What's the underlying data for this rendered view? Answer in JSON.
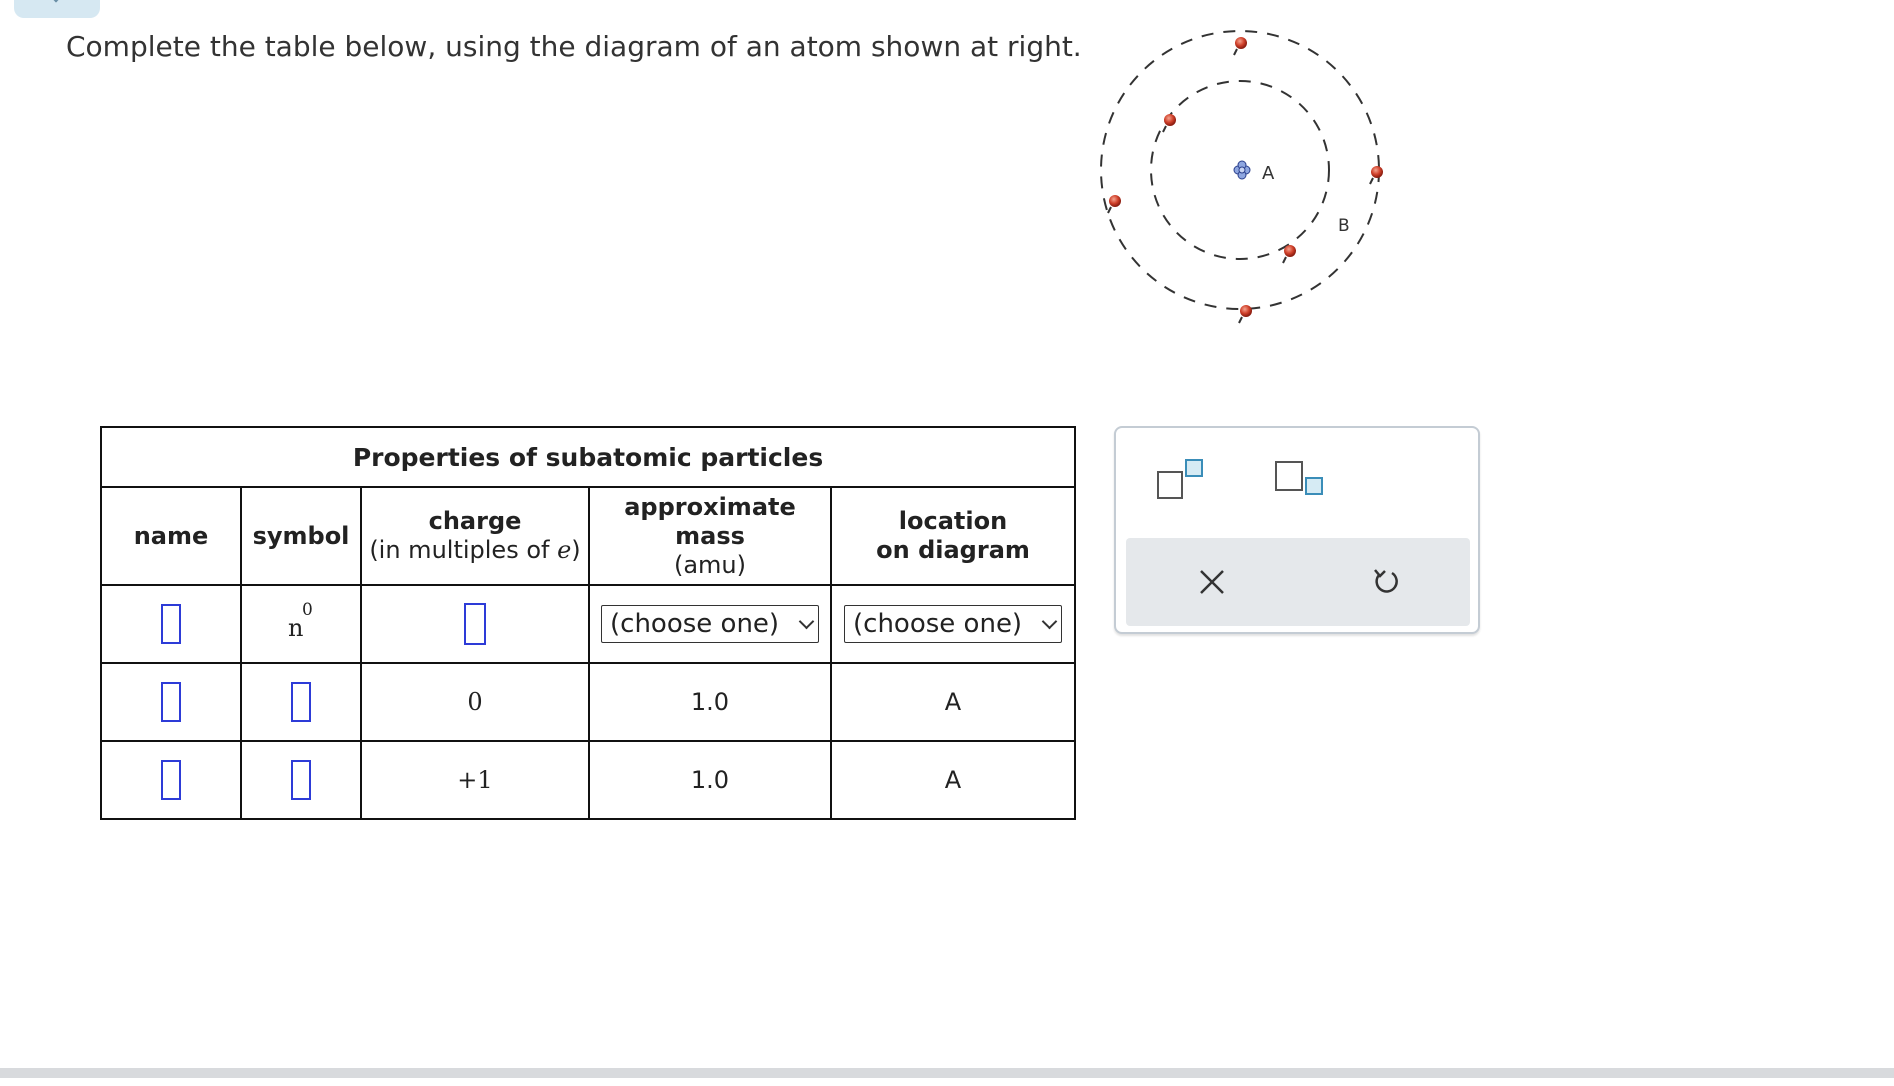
{
  "instruction": "Complete the table below, using the diagram of an atom shown at right.",
  "diagram": {
    "label_nucleus": "A",
    "label_shell": "B"
  },
  "table": {
    "caption": "Properties of subatomic particles",
    "headers": {
      "name": "name",
      "symbol": "symbol",
      "charge_line1": "charge",
      "charge_line2_prefix": "(in multiples of ",
      "charge_line2_var": "e",
      "charge_line2_suffix": ")",
      "mass_line1": "approximate",
      "mass_line2": "mass",
      "mass_line3": "(amu)",
      "location_line1": "location",
      "location_line2": "on diagram"
    },
    "rows": [
      {
        "symbol_sup": "0",
        "symbol_base": "n",
        "mass_select": "(choose one)",
        "location_select": "(choose one)"
      },
      {
        "charge": "0",
        "mass": "1.0",
        "location": "A"
      },
      {
        "charge": "+1",
        "mass": "1.0",
        "location": "A"
      }
    ]
  },
  "palette": {
    "tools": [
      "superscript-box-icon",
      "subscript-box-icon",
      "clear-icon",
      "undo-icon"
    ]
  }
}
